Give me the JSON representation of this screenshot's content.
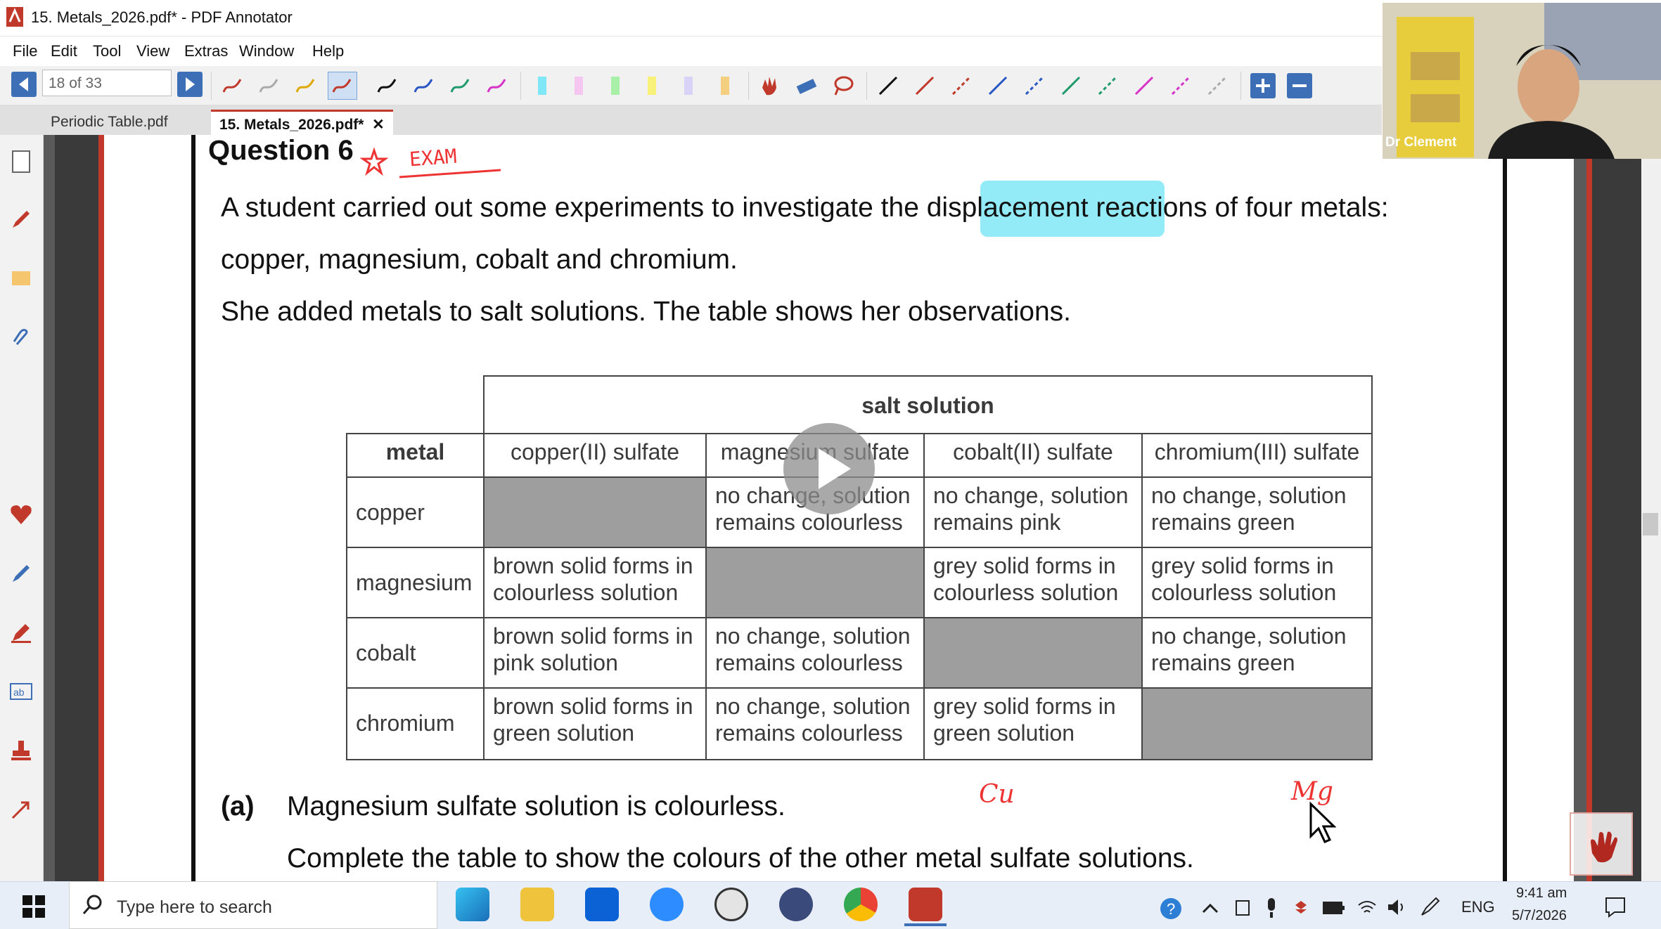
{
  "window": {
    "title": "15. Metals_2026.pdf* - PDF Annotator"
  },
  "menu": [
    "File",
    "Edit",
    "Tool",
    "View",
    "Extras",
    "Window",
    "Help"
  ],
  "toolbar": {
    "page_value": "18 of 33"
  },
  "tabs": [
    {
      "label": "Periodic Table.pdf"
    },
    {
      "label": "15. Metals_2026.pdf*",
      "close": "✕"
    }
  ],
  "document": {
    "question_title": "Question 6",
    "annotation_exam": "EXAM",
    "intro_line1_before": "A student carried out some experiments to investigate the",
    "intro_highlight": "displacement",
    "intro_line1_after": "reactions of four metals:",
    "intro_line2": "copper, magnesium, cobalt and chromium.",
    "intro_line3": "She added metals to salt solutions. The table shows her observations.",
    "table": {
      "group_header": "salt solution",
      "row_header": "metal",
      "columns": [
        "copper(II) sulfate",
        "magnesium sulfate",
        "cobalt(II) sulfate",
        "chromium(III) sulfate"
      ],
      "rows": [
        {
          "metal": "copper",
          "cells": [
            "",
            "no change, solution\nremains colourless",
            "no change, solution\nremains pink",
            "no change, solution\nremains green"
          ]
        },
        {
          "metal": "magnesium",
          "cells": [
            "brown solid forms in\ncolourless solution",
            "",
            "grey solid forms in\ncolourless solution",
            "grey solid forms in\ncolourless solution"
          ]
        },
        {
          "metal": "cobalt",
          "cells": [
            "brown solid forms in\npink solution",
            "no change, solution\nremains colourless",
            "",
            "no change, solution\nremains green"
          ]
        },
        {
          "metal": "chromium",
          "cells": [
            "brown solid forms in\ngreen solution",
            "no change, solution\nremains colourless",
            "grey solid forms in\ngreen solution",
            ""
          ]
        }
      ]
    },
    "part_label": "(a)",
    "part_line1": "Magnesium sulfate solution is colourless.",
    "part_line2": "Complete the table to show the colours of the other metal sulfate solutions.",
    "handwriting_cu": "Cu",
    "handwriting_mg": "Mg"
  },
  "video": {
    "name": "Dr Clement"
  },
  "taskbar": {
    "search_placeholder": "Type here to search",
    "language": "ENG",
    "time": "9:41 am",
    "date": "5/7/2026"
  },
  "colors": {
    "accent": "#c0392b",
    "highlight": "#7fe7f5",
    "nav": "#3d6fb6"
  }
}
